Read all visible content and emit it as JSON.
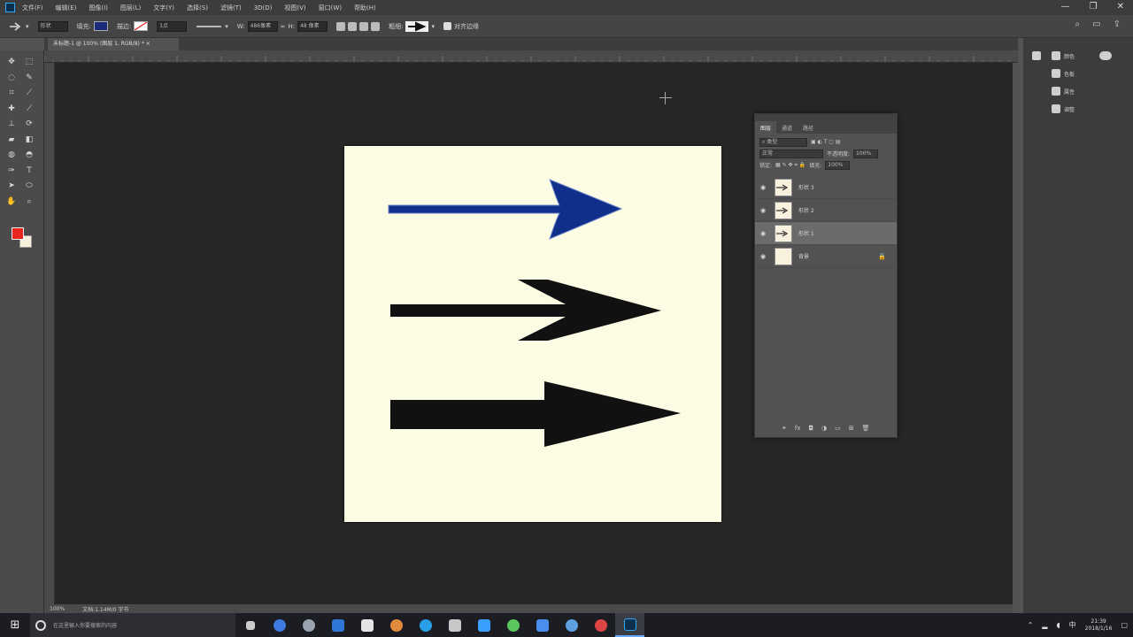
{
  "app": {
    "menu": [
      "文件(F)",
      "编辑(E)",
      "图像(I)",
      "图层(L)",
      "文字(Y)",
      "选择(S)",
      "滤镜(T)",
      "3D(D)",
      "视图(V)",
      "窗口(W)",
      "帮助(H)"
    ],
    "window_controls": [
      "—",
      "❐",
      "✕"
    ]
  },
  "options": {
    "mode_label": "形状",
    "fill_label": "填充:",
    "fill_color": "#1b2a7a",
    "stroke_label": "描边:",
    "stroke_width": "1点",
    "w_label": "W:",
    "w_value": "486像素",
    "h_label": "H:",
    "h_value": "48 像素",
    "weight_label": "粗细:",
    "align_label": "对齐边缘"
  },
  "document": {
    "tab_title": "未标题-1 @ 100% (图层 1, RGB/8) *",
    "status_zoom": "100%",
    "status_doc": "文档:1.14M/0 字节",
    "background": "#fcfbe4"
  },
  "toolbar": {
    "tools": [
      "move-tool-icon",
      "marquee-tool-icon",
      "lasso-tool-icon",
      "quick-select-tool-icon",
      "crop-tool-icon",
      "eyedropper-tool-icon",
      "healing-tool-icon",
      "brush-tool-icon",
      "stamp-tool-icon",
      "history-brush-tool-icon",
      "eraser-tool-icon",
      "gradient-tool-icon",
      "blur-tool-icon",
      "dodge-tool-icon",
      "pen-tool-icon",
      "type-tool-icon",
      "path-select-tool-icon",
      "custom-shape-tool-icon",
      "hand-tool-icon",
      "zoom-tool-icon"
    ],
    "fg_color": "#e8251e",
    "bg_color": "#f7f1dd"
  },
  "layers_panel": {
    "tabs": [
      "图层",
      "通道",
      "路径"
    ],
    "kind_label": "类型",
    "blend_mode": "正常",
    "opacity_label": "不透明度:",
    "opacity": "100%",
    "lock_label": "锁定:",
    "fill_label": "填充:",
    "fill": "100%",
    "layers": [
      {
        "name": "形状 3",
        "selected": false
      },
      {
        "name": "形状 2",
        "selected": false
      },
      {
        "name": "形状 1",
        "selected": true
      },
      {
        "name": "背景",
        "selected": false
      }
    ]
  },
  "right_dock": {
    "col1": [
      "颜色",
      "色板"
    ],
    "col2": [
      "属性",
      "调整"
    ]
  },
  "arrows": [
    {
      "color": "#102f8a",
      "style": "thin-curved"
    },
    {
      "color": "#111111",
      "style": "chevron-line"
    },
    {
      "color": "#111111",
      "style": "block"
    }
  ],
  "taskbar": {
    "search_placeholder": "在这里输入你要搜索的内容",
    "time": "21:39",
    "date": "2018/1/16"
  }
}
